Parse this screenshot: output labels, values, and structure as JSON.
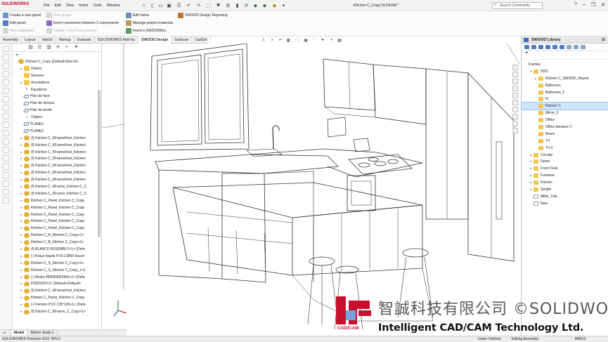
{
  "app": {
    "logo": "SOLIDWORKS",
    "document_title": "Kitchen C_Copy.SLDASM *",
    "search_placeholder": "Search Commands"
  },
  "menu": [
    "File",
    "Edit",
    "View",
    "Insert",
    "Tools",
    "Window"
  ],
  "ribbon": {
    "create_panel": "Create a new panel",
    "edit_panel": "Edit panel",
    "new_edge_band": "New edgeband",
    "new_shape": "New shape",
    "insert_connectors": "Insert connectors between 2 components",
    "create_frame_project": "Create a new frame project",
    "edit_frame": "Edit frame",
    "manage_materials": "Manage project materials",
    "insert_swoodbox": "Insert a SWOODBox",
    "design_reporting": "SWOOD Design Reporting"
  },
  "tabs": [
    "Assembly",
    "Layout",
    "Sketch",
    "Markup",
    "Evaluate",
    "SOLIDWORKS Add-Ins",
    "SWOOD Design",
    "Surfaces",
    "CadGio"
  ],
  "active_tab": "SWOOD Design",
  "tree": [
    {
      "label": "Kitchen C_Copy  (Default<Etat d'a",
      "icon": "asm",
      "exp": ""
    },
    {
      "label": "History",
      "icon": "fold",
      "exp": "▸"
    },
    {
      "label": "Sensors",
      "icon": "fold",
      "exp": ""
    },
    {
      "label": "Annotations",
      "icon": "fold",
      "exp": "▸"
    },
    {
      "label": "Equations",
      "icon": "feat",
      "exp": ""
    },
    {
      "label": "Plan de face",
      "icon": "plane",
      "exp": ""
    },
    {
      "label": "Plan de dessus",
      "icon": "plane",
      "exp": ""
    },
    {
      "label": "Plan de droite",
      "icon": "plane",
      "exp": ""
    },
    {
      "label": "Origine",
      "icon": "origin",
      "exp": ""
    },
    {
      "label": "PLANE1",
      "icon": "plane",
      "exp": ""
    },
    {
      "label": "PLANE2",
      "icon": "plane",
      "exp": ""
    },
    {
      "label": "(f) Kitchen C_KFrameFeet_Kitchen",
      "icon": "asm",
      "exp": "▸"
    },
    {
      "label": "(f) Kitchen C_KFrameFeet_Kitchen",
      "icon": "asm",
      "exp": "▸"
    },
    {
      "label": "(f) Kitchen C_KFrameFeet_Kitchen",
      "icon": "asm",
      "exp": "▸"
    },
    {
      "label": "(f) Kitchen C_KFrameFeet_Kitchen",
      "icon": "asm",
      "exp": "▸"
    },
    {
      "label": "(f) Kitchen C_KFrameFeet_Kitchen",
      "icon": "asm",
      "exp": "▸"
    },
    {
      "label": "(f) Kitchen C_KFrameFeet_Kitchen",
      "icon": "asm",
      "exp": "▸"
    },
    {
      "label": "(f) Kitchen C_KFrameFeet_Kitchen",
      "icon": "asm",
      "exp": "▸"
    },
    {
      "label": "(f) Kitchen C_KFrame_Kitchen C_C",
      "icon": "asm",
      "exp": "▸"
    },
    {
      "label": "(f) Kitchen C_KFrame_Kitchen C_C",
      "icon": "asm",
      "exp": "▸"
    },
    {
      "label": "Kitchen C_Panel_Kitchen C_Copy",
      "icon": "asm",
      "exp": "▸"
    },
    {
      "label": "Kitchen C_Panel_Kitchen C_Copy",
      "icon": "asm",
      "exp": "▸"
    },
    {
      "label": "Kitchen C_Panel_Kitchen C_Copy",
      "icon": "asm",
      "exp": "▸"
    },
    {
      "label": "Kitchen C_Panel_Kitchen C_Copy",
      "icon": "asm",
      "exp": "▸"
    },
    {
      "label": "Kitchen C_Panel_Kitchen C_Copy",
      "icon": "asm",
      "exp": "▸"
    },
    {
      "label": "Kitchen C_R_Kitchen C_Copy<1>",
      "icon": "asm",
      "exp": "▸"
    },
    {
      "label": "Kitchen C_B_Kitchen C_Copy<1>",
      "icon": "asm",
      "exp": "▸"
    },
    {
      "label": "(f) BLANCO ASSEMBLY<1> (Defa",
      "icon": "asm",
      "exp": "▸"
    },
    {
      "label": "(-) Kraus Aquila FVS-13800 faucet",
      "icon": "asm",
      "exp": "▸"
    },
    {
      "label": "Kitchen C_S_Kitchen C_Copy<1>",
      "icon": "asm",
      "exp": "▸"
    },
    {
      "label": "Kitchen C_S_Kitchen C_Copy_1<1",
      "icon": "asm",
      "exp": "▸"
    },
    {
      "label": "(-) Bosko BIR354IDXMS<1> (Defa",
      "icon": "asm",
      "exp": "▸"
    },
    {
      "label": "P2691GH<1> (Default<Default>",
      "icon": "asm",
      "exp": "▸"
    },
    {
      "label": "(f) Kitchen C_KFrameFeet_Kitchen",
      "icon": "asm",
      "exp": "▸"
    },
    {
      "label": "Kitchen C_Panel_Kitchen C_Copy",
      "icon": "asm",
      "exp": "▸"
    },
    {
      "label": "(-) Fenetre PVC 135*120<1> (Defa",
      "icon": "asm",
      "exp": "▸"
    },
    {
      "label": "(f) Kitchen C_KFrame_C_Copy<1>",
      "icon": "asm",
      "exp": "▸"
    }
  ],
  "bottom_tabs": [
    "Model",
    "Motion Study 1"
  ],
  "status": {
    "version": "SOLIDWORKS Premium 2021 SP0.0",
    "definition": "Under Defined",
    "mode": "Editing Assembly",
    "units": "MMGS"
  },
  "library": {
    "title": "SWOOD Library",
    "filter_icon": "filter-icon",
    "items": [
      {
        "label": "Frames",
        "indent": 0,
        "exp": "",
        "icon": "none",
        "sel": false
      },
      {
        "label": "2021",
        "indent": 1,
        "exp": "▾",
        "icon": "fold",
        "sel": false
      },
      {
        "label": "Kitchen C_SWOOD_Report",
        "indent": 2,
        "exp": "▸",
        "icon": "fold",
        "sel": false
      },
      {
        "label": "Bathroom",
        "indent": 2,
        "exp": "",
        "icon": "fold",
        "sel": false
      },
      {
        "label": "Bathroom_F",
        "indent": 2,
        "exp": "",
        "icon": "fold",
        "sel": false
      },
      {
        "label": "KI",
        "indent": 2,
        "exp": "",
        "icon": "fold",
        "sel": false
      },
      {
        "label": "Kitchen C",
        "indent": 2,
        "exp": "",
        "icon": "fold",
        "sel": true
      },
      {
        "label": "Mirror_F",
        "indent": 2,
        "exp": "",
        "icon": "fold",
        "sel": false
      },
      {
        "label": "Office",
        "indent": 2,
        "exp": "",
        "icon": "fold",
        "sel": false
      },
      {
        "label": "Office furniture C",
        "indent": 2,
        "exp": "",
        "icon": "fold",
        "sel": false
      },
      {
        "label": "Room",
        "indent": 2,
        "exp": "",
        "icon": "fold",
        "sel": false
      },
      {
        "label": "TV",
        "indent": 2,
        "exp": "",
        "icon": "fold",
        "sel": false
      },
      {
        "label": "TV-2",
        "indent": 2,
        "exp": "",
        "icon": "fold",
        "sel": false
      },
      {
        "label": "Circular",
        "indent": 1,
        "exp": "▸",
        "icon": "fold",
        "sel": false
      },
      {
        "label": "Demo",
        "indent": 1,
        "exp": "▸",
        "icon": "fold",
        "sel": false
      },
      {
        "label": "Front Desk",
        "indent": 1,
        "exp": "▸",
        "icon": "fold",
        "sel": false
      },
      {
        "label": "Furniture",
        "indent": 1,
        "exp": "▸",
        "icon": "fold",
        "sel": false
      },
      {
        "label": "Kitchen",
        "indent": 1,
        "exp": "▸",
        "icon": "fold",
        "sel": false
      },
      {
        "label": "Simple",
        "indent": 1,
        "exp": "▸",
        "icon": "fold",
        "sel": false
      },
      {
        "label": "Miller_Cab",
        "indent": 1,
        "exp": "",
        "icon": "file",
        "sel": false
      },
      {
        "label": "New",
        "indent": 1,
        "exp": "",
        "icon": "file",
        "sel": false
      }
    ]
  },
  "watermark": {
    "cn": "智誠科技有限公司 ©SOLIDWORKS智誠",
    "en": "Intelligent CAD/CAM Technology Ltd.",
    "logo_text": "CAD/CAM"
  },
  "colors": {
    "accent": "#c8102e",
    "selection": "#cfe5fb",
    "folder": "#f1c64a"
  }
}
